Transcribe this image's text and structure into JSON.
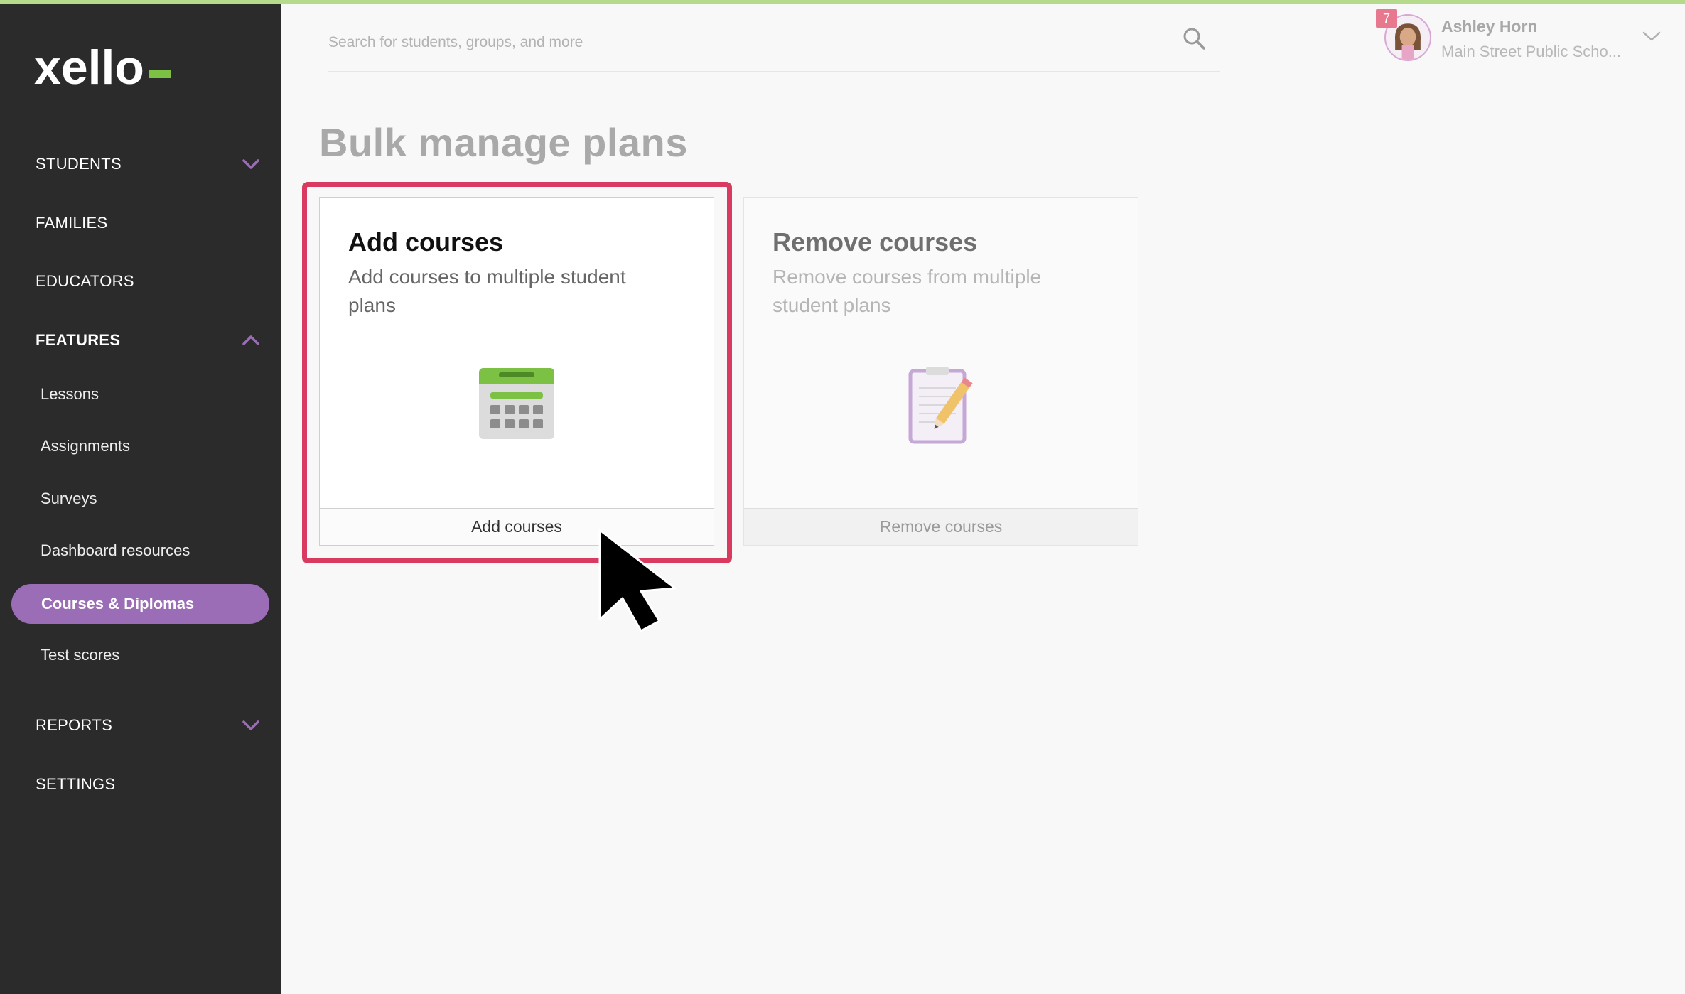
{
  "app": {
    "logo_text": "xello",
    "accent_color": "#9b6db6",
    "brand_green": "#7cc143"
  },
  "sidebar": {
    "items": [
      {
        "label": "STUDENTS",
        "expandable": true,
        "expanded": false
      },
      {
        "label": "FAMILIES"
      },
      {
        "label": "EDUCATORS"
      },
      {
        "label": "FEATURES",
        "expandable": true,
        "expanded": true
      },
      {
        "label": "REPORTS",
        "expandable": true,
        "expanded": false
      },
      {
        "label": "SETTINGS"
      }
    ],
    "features_subitems": [
      "Lessons",
      "Assignments",
      "Surveys",
      "Dashboard resources",
      "Courses & Diplomas",
      "Test scores"
    ],
    "active_subitem": "Courses & Diplomas"
  },
  "search": {
    "placeholder": "Search for students, groups, and more"
  },
  "profile": {
    "name": "Ashley Horn",
    "school": "Main Street Public Scho...",
    "notification_count": "7"
  },
  "main": {
    "title": "Bulk manage plans",
    "cards": [
      {
        "title": "Add courses",
        "description": "Add courses to multiple student plans",
        "button": "Add courses",
        "icon": "calendar-icon"
      },
      {
        "title": "Remove courses",
        "description": "Remove courses from multiple student plans",
        "button": "Remove courses",
        "icon": "clipboard-pencil-icon"
      }
    ]
  }
}
